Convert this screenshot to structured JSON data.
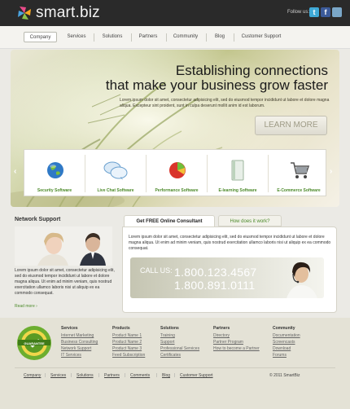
{
  "header": {
    "logo_text": "smart.biz",
    "follow_label": "Follow us:",
    "social": [
      {
        "icon": "twitter-icon",
        "glyph": "t",
        "color": "#3fa9d6"
      },
      {
        "icon": "facebook-icon",
        "glyph": "f",
        "color": "#3b5a99"
      },
      {
        "icon": "other-social-icon",
        "glyph": "",
        "color": "#7aa7c8"
      }
    ]
  },
  "nav": {
    "items": [
      "Company",
      "Services",
      "Solutions",
      "Partners",
      "Community",
      "Blog",
      "Customer Support"
    ],
    "active": "Company"
  },
  "hero": {
    "heading_line1": "Establishing connections",
    "heading_line2": "that make your business grow faster",
    "text": "Lorem ipsum dolor sit amet, consectetur adipisicing elit, sed do eiusmod tempor incididunt ut labore et dolore magna aliqua. Excepteur sint proident, sunt in culpa deserunt mollit anim id est laborum.",
    "button_label": "LEARN MORE",
    "cards": [
      {
        "label": "Security Software",
        "icon": "globe-icon"
      },
      {
        "label": "Live Chat Software",
        "icon": "chat-bubbles-icon"
      },
      {
        "label": "Performance Software",
        "icon": "pie-chart-icon"
      },
      {
        "label": "E-learning Software",
        "icon": "book-icon"
      },
      {
        "label": "E-Commerce Software",
        "icon": "shopping-cart-icon"
      }
    ],
    "prev_arrow": "‹",
    "next_arrow": "›"
  },
  "network": {
    "title": "Network Support",
    "text": "Lorem ipsum dolor sit amet, consectetur adipisicing elit, sed do eiusmod tempor incididunt ut labore et dolore magna aliqua. Ut enim ad minim veniam, quis nostrud exercitation ullamco laboris nisi ut aliquip ex ea commodo consequat.",
    "read_more": "Read more ›"
  },
  "consultant": {
    "tab_active": "Get FREE Online Consultant",
    "tab_other": "How does it work?",
    "text": "Lorem ipsum dolor sit amet, consectetur adipisicing elit, sed do eiusmod tempor incididunt ut labore et dolore magna aliqua. Ut enim ad minim veniam, quis nostrud exercitation ullamco laboris nisi ut aliquip ex ea commodo consequat.",
    "call_label": "CALL US:",
    "phone1": "1.800.123.4567",
    "phone2": "1.800.891.0111"
  },
  "footer": {
    "badge_text": "GUARANTEE",
    "columns": [
      {
        "title": "Services",
        "items": [
          "Internet Marketing",
          "Business Consulting",
          "Network Support",
          "IT Services"
        ]
      },
      {
        "title": "Products",
        "items": [
          "Product Name 1",
          "Product Name 2",
          "Product Name 3",
          "Feed Subscription"
        ]
      },
      {
        "title": "Solutions",
        "items": [
          "Training",
          "Support",
          "Professional Services",
          "Certificates"
        ]
      },
      {
        "title": "Partners",
        "items": [
          "Directory",
          "Partner Program",
          "How to become a Partner"
        ]
      },
      {
        "title": "Community",
        "items": [
          "Documentation",
          "Screencasts",
          "Download",
          "Forums"
        ]
      }
    ],
    "bottom_nav": [
      "Company",
      "Services",
      "Solutions",
      "Partners",
      "Comments",
      "Blog",
      "Customer Support"
    ],
    "copyright": "© 2011 SmartBiz"
  }
}
